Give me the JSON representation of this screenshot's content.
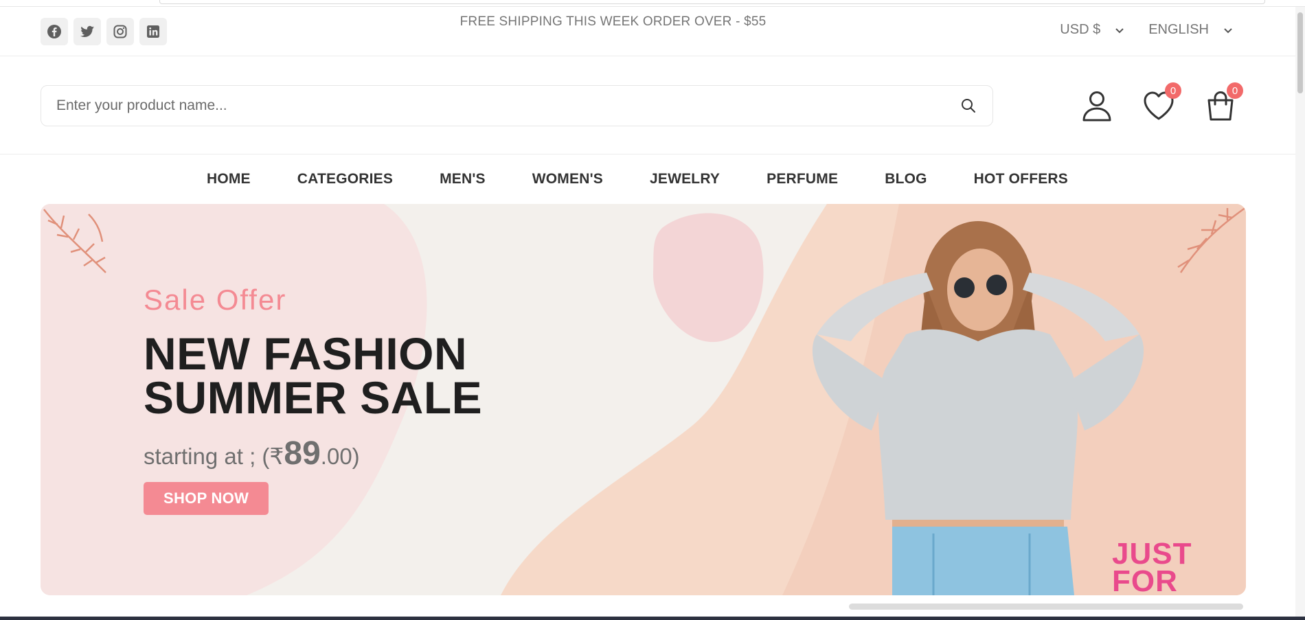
{
  "topbar": {
    "socials": [
      {
        "icon": "facebook-icon"
      },
      {
        "icon": "twitter-icon"
      },
      {
        "icon": "instagram-icon"
      },
      {
        "icon": "linkedin-icon"
      }
    ],
    "shipping_text": "FREE SHIPPING THIS WEEK ORDER OVER - $55",
    "currency": "USD $",
    "language": "ENGLISH"
  },
  "header": {
    "search_placeholder": "Enter your product name...",
    "wishlist_count": "0",
    "cart_count": "0"
  },
  "nav": {
    "items": [
      "HOME",
      "CATEGORIES",
      "MEN'S",
      "WOMEN'S",
      "JEWELRY",
      "PERFUME",
      "BLOG",
      "HOT OFFERS"
    ]
  },
  "banner": {
    "subtitle": "Sale Offer",
    "title_line1": "NEW FASHION",
    "title_line2": "SUMMER SALE",
    "price_prefix": "starting at ; (₹",
    "price_amount": "89",
    "price_suffix": ".00)",
    "cta_label": "SHOP NOW",
    "corner_text_line1": "JUST",
    "corner_text_line2": "FOR"
  },
  "colors": {
    "accent": "#f48a93",
    "badge": "#f26a6a",
    "title": "#1f1f1f",
    "muted": "#757575"
  }
}
